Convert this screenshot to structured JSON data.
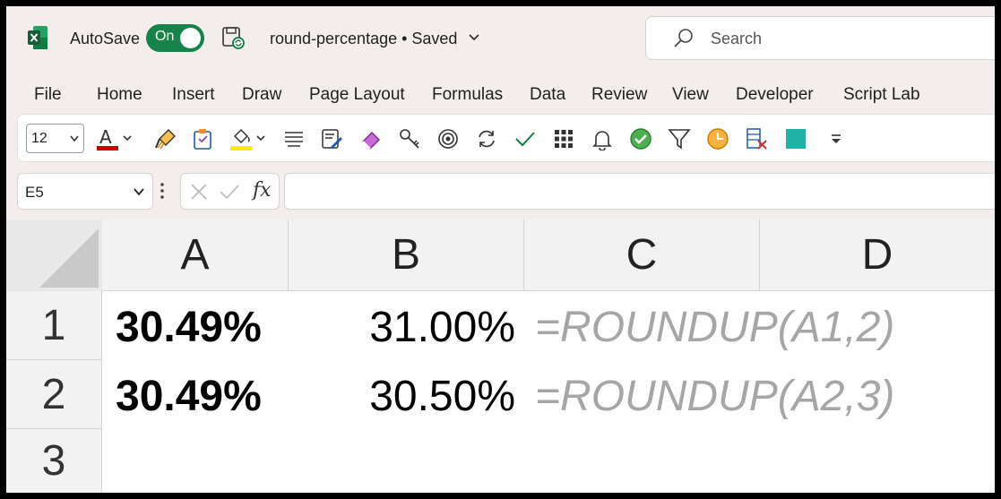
{
  "app": {
    "autosave_label": "AutoSave",
    "autosave_state": "On",
    "document_title": "round-percentage • Saved",
    "search_placeholder": "Search"
  },
  "menu": [
    "File",
    "Home",
    "Insert",
    "Draw",
    "Page Layout",
    "Formulas",
    "Data",
    "Review",
    "View",
    "Developer",
    "Script Lab"
  ],
  "ribbon": {
    "font_size": "12",
    "icons": [
      "font-color-icon",
      "format-painter-icon",
      "clipboard-icon",
      "fill-color-icon",
      "align-icon",
      "form-icon",
      "eraser-icon",
      "key-icon",
      "target-icon",
      "refresh-icon",
      "checkmark-icon",
      "grid-icon",
      "bell-icon",
      "check-circle-icon",
      "filter-icon",
      "clock-icon",
      "delete-column-icon",
      "teal-square-icon",
      "overflow-icon"
    ],
    "font_color": "#d10000",
    "fill_color": "#ffeb00"
  },
  "formula_bar": {
    "name_box": "E5",
    "fx_label": "fx",
    "formula": ""
  },
  "sheet": {
    "columns": [
      "A",
      "B",
      "C",
      "D"
    ],
    "rows": [
      "1",
      "2",
      "3"
    ],
    "cells": {
      "A1": "30.49%",
      "B1": "31.00%",
      "C1": "=ROUNDUP(A1,2)",
      "A2": "30.49%",
      "B2": "30.50%",
      "C2": "=ROUNDUP(A2,3)"
    }
  },
  "colors": {
    "toggle_on": "#17824a",
    "excel_green": "#107c41",
    "formula_text": "#a6a6a6"
  }
}
